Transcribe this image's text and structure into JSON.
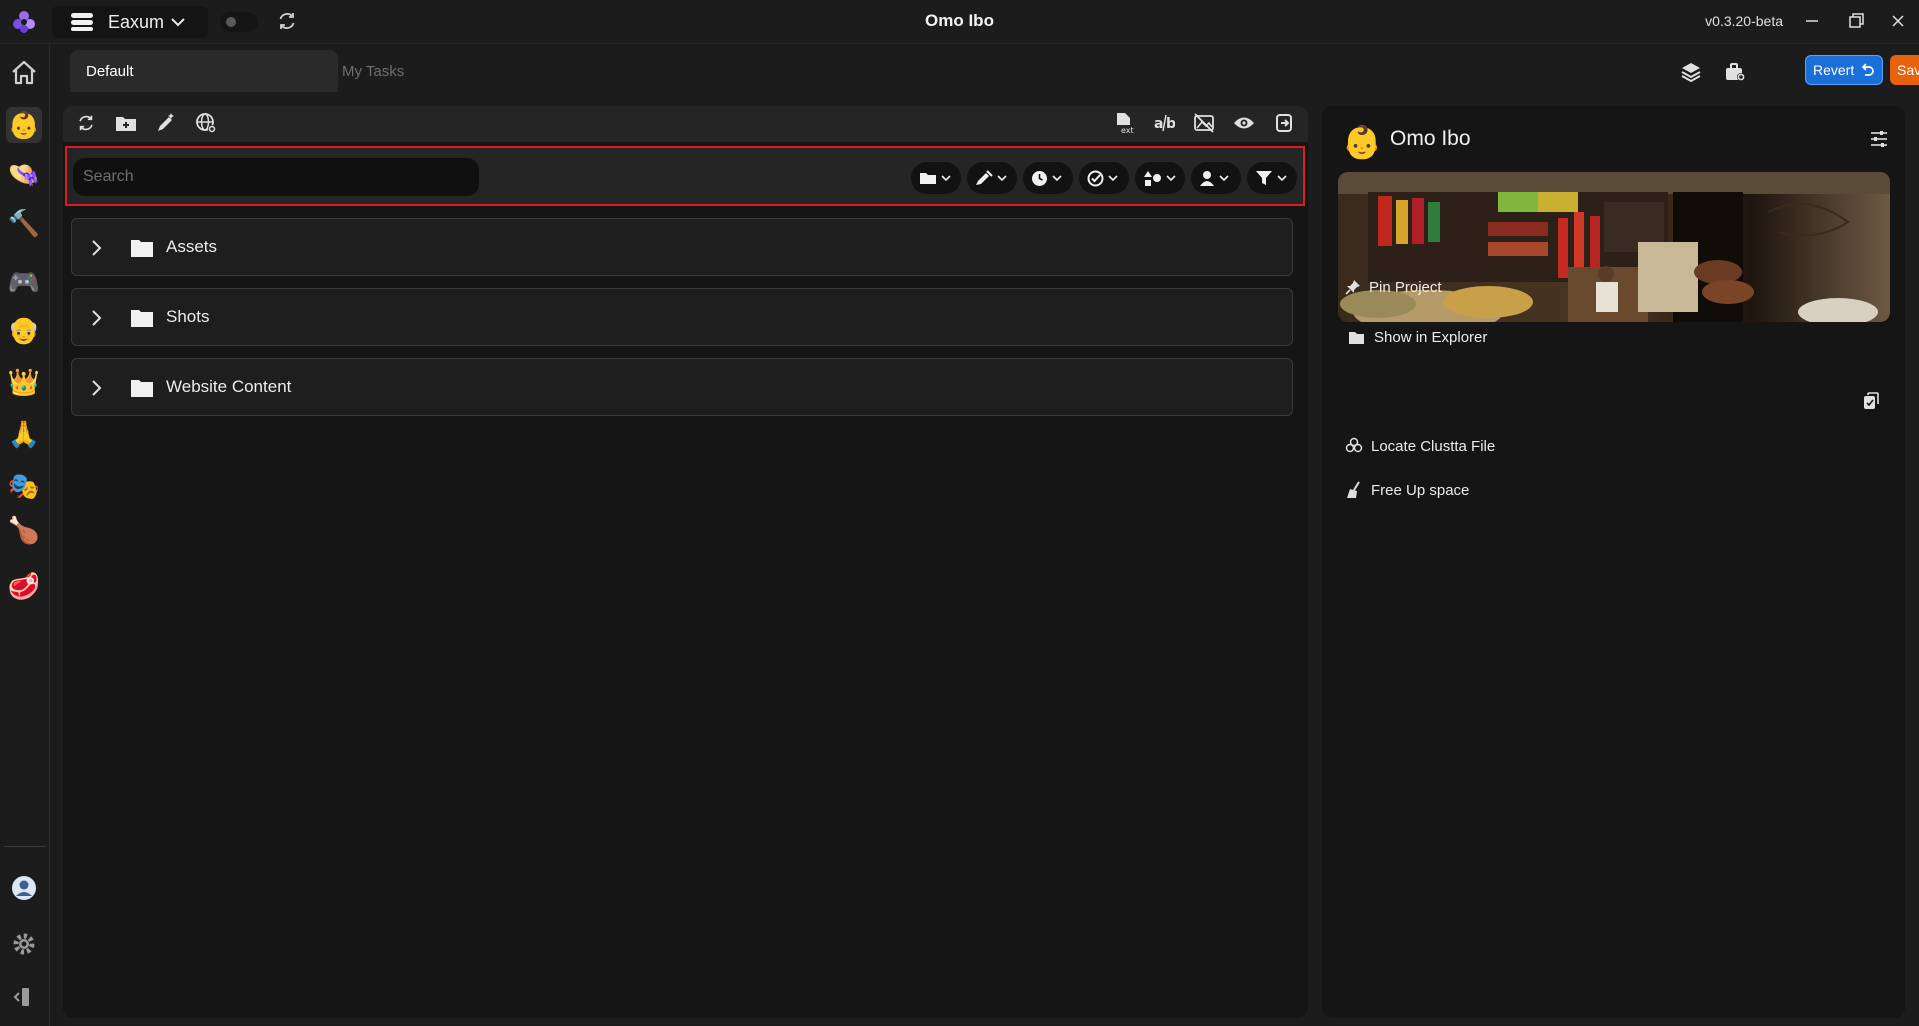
{
  "titlebar": {
    "workspace": "Eaxum",
    "title": "Omo Ibo",
    "version": "v0.3.20-beta"
  },
  "rail": {
    "items": [
      {
        "name": "home-icon",
        "glyph": "home"
      },
      {
        "name": "rail-project-omo-ibo",
        "glyph": "👶"
      },
      {
        "name": "rail-project-hat",
        "glyph": "👒"
      },
      {
        "name": "rail-project-hammer",
        "glyph": "🔨"
      },
      {
        "name": "rail-project-gamepad",
        "glyph": "🎮"
      },
      {
        "name": "rail-project-face",
        "glyph": "👴"
      },
      {
        "name": "rail-project-crown",
        "glyph": "👑"
      },
      {
        "name": "rail-project-pray",
        "glyph": "🙏"
      },
      {
        "name": "rail-project-masks",
        "glyph": "🎭"
      },
      {
        "name": "rail-project-drumstick",
        "glyph": "🍗"
      },
      {
        "name": "rail-project-meat",
        "glyph": "🥩"
      }
    ]
  },
  "tabs": [
    {
      "label": "Default",
      "active": true
    },
    {
      "label": "My Tasks",
      "active": false
    }
  ],
  "header": {
    "revert_label": "Revert",
    "save_label": "Save"
  },
  "search": {
    "placeholder": "Search"
  },
  "tree": [
    {
      "label": "Assets"
    },
    {
      "label": "Shots"
    },
    {
      "label": "Website Content"
    }
  ],
  "project": {
    "name": "Omo Ibo",
    "avatar": "👶",
    "actions": {
      "pin": "Pin Project",
      "explorer": "Show in Explorer",
      "locate": "Locate Clustta File",
      "free": "Free Up space"
    }
  },
  "colors": {
    "accent_blue": "#1a6fd8",
    "accent_orange": "#e8620e",
    "highlight_red": "#d81e1e"
  }
}
